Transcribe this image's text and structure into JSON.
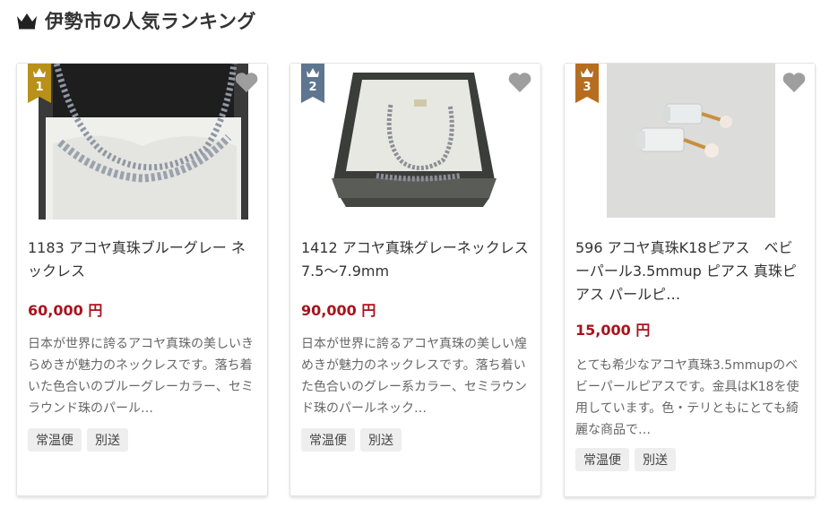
{
  "header": {
    "title": "伊勢市の人気ランキング",
    "icon": "crown-icon"
  },
  "products": [
    {
      "rank": "1",
      "name": "1183 アコヤ真珠ブルーグレー ネックレス",
      "price": "60,000 円",
      "description": "日本が世界に誇るアコヤ真珠の美しいきらめきが魅力のネックレスです。落ち着いた色合いのブルーグレーカラー、セミラウンド珠のパール…",
      "tags": [
        "常温便",
        "別送"
      ],
      "rank_color": "#b8901a"
    },
    {
      "rank": "2",
      "name": "1412 アコヤ真珠グレーネックレス7.5〜7.9mm",
      "price": "90,000 円",
      "description": "日本が世界に誇るアコヤ真珠の美しい煌めきが魅力のネックレスです。落ち着いた色合いのグレー系カラー、セミラウンド珠のパールネック…",
      "tags": [
        "常温便",
        "別送"
      ],
      "rank_color": "#5e7590"
    },
    {
      "rank": "3",
      "name": "596 アコヤ真珠K18ピアス　ベビーパール3.5mmup ピアス 真珠ピアス パールピ…",
      "price": "15,000 円",
      "description": "とても希少なアコヤ真珠3.5mmupのベビーパールピアスです。金具はK18を使用しています。色・テリともにとても綺麗な商品で…",
      "tags": [
        "常温便",
        "別送"
      ],
      "rank_color": "#b76d1f"
    }
  ],
  "colors": {
    "price": "#a8141d",
    "fav_icon": "#9e9e9e",
    "tag_bg": "#eeeeee"
  }
}
